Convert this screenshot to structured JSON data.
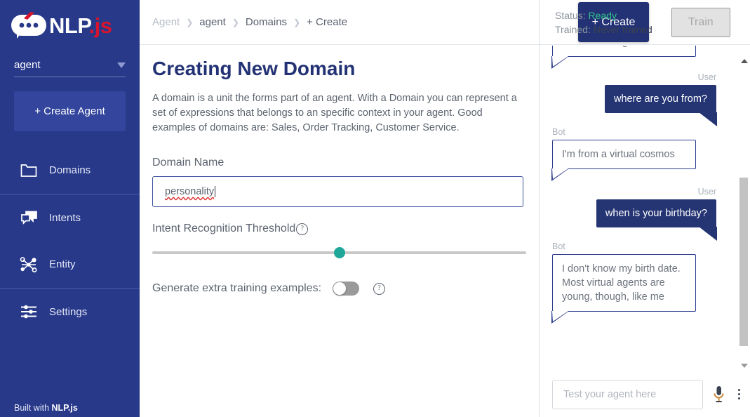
{
  "sidebar": {
    "logo": {
      "name": "NLP",
      "suffix": ".js",
      "icon": "chat-bubble-logo-icon"
    },
    "agent_selector": {
      "value": "agent",
      "caret_icon": "caret-down-icon"
    },
    "create_agent_label": "+ Create Agent",
    "items": [
      {
        "label": "Domains",
        "icon": "folder-icon"
      },
      {
        "label": "Intents",
        "icon": "chat-bubbles-icon"
      },
      {
        "label": "Entity",
        "icon": "node-graph-icon"
      },
      {
        "label": "Settings",
        "icon": "sliders-icon"
      }
    ],
    "footer": {
      "prefix": "Built with ",
      "brand": "NLP.js"
    }
  },
  "topbar": {
    "breadcrumbs": [
      {
        "label": "Agent",
        "muted": true
      },
      {
        "label": "agent",
        "muted": false
      },
      {
        "label": "Domains",
        "muted": false
      },
      {
        "label": "+ Create",
        "muted": false
      }
    ],
    "separator": "❯",
    "create_button": "+ Create"
  },
  "main": {
    "title": "Creating New Domain",
    "description": "A domain is a unit the forms part of an agent. With a Domain you can represent a set of expressions that belongs to an specific context in your agent. Good examples of domains are: Sales, Order Tracking, Customer Service.",
    "domain_name": {
      "label": "Domain Name",
      "value": "personality",
      "placeholder": ""
    },
    "threshold": {
      "label": "Intent Recognition Threshold",
      "help_icon": "help-circle-icon",
      "percent": 50
    },
    "generate_examples": {
      "label": "Generate extra training examples:",
      "enabled": false,
      "help_icon": "help-circle-icon"
    }
  },
  "chat": {
    "status": {
      "status_key": "Status:",
      "status_value": "Ready",
      "trained_key": "Trained:",
      "trained_value": "Never trained"
    },
    "train_button": "Train",
    "messages": [
      {
        "role": "bot",
        "role_label": "",
        "text": "I'm a virtual agent",
        "clipped": true
      },
      {
        "role": "user",
        "role_label": "User",
        "text": "where are you from?"
      },
      {
        "role": "bot",
        "role_label": "Bot",
        "text": "I'm from a virtual cosmos"
      },
      {
        "role": "user",
        "role_label": "User",
        "text": "when is your birthday?"
      },
      {
        "role": "bot",
        "role_label": "Bot",
        "text": "I don't know my birth date. Most virtual agents are young, though, like me"
      }
    ],
    "input_placeholder": "Test your agent here",
    "mic_icon": "microphone-icon",
    "menu_icon": "kebab-menu-icon",
    "scroll_up_icon": "scroll-up-arrow-icon",
    "scroll_down_icon": "scroll-down-arrow-icon"
  },
  "colors": {
    "sidebar_bg": "#28398a",
    "accent_navy": "#233274",
    "slider_teal": "#1fa79a",
    "status_green": "#2fc08a",
    "logo_red": "#d6142e"
  }
}
